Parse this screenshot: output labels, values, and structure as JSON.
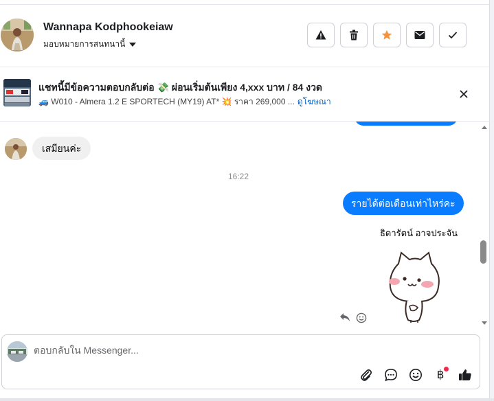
{
  "header": {
    "contact_name": "Wannapa Kodphookeiaw",
    "assign_label": "มอบหมายการสนทนานี้",
    "actions": [
      {
        "name": "report-button",
        "icon": "warning-icon"
      },
      {
        "name": "delete-button",
        "icon": "trash-icon"
      },
      {
        "name": "star-button",
        "icon": "star-icon",
        "color": "#f7923b"
      },
      {
        "name": "mark-unread-button",
        "icon": "envelope-icon"
      },
      {
        "name": "mark-done-button",
        "icon": "check-icon"
      }
    ]
  },
  "ad": {
    "title": "แชทนี้มีข้อความตอบกลับต่อ 💸 ผ่อนเริ่มต้นเพียง 4,xxx บาท / 84 งวด",
    "subtitle": "🚙 W010 - Almera 1.2 E SPORTECH (MY19) AT* 💥 ราคา 269,000 ...",
    "link_label": "ดูโฆษณา"
  },
  "chat": {
    "incoming_message": "เสมียนค่ะ",
    "timestamp": "16:22",
    "outgoing_message": "รายได้ต่อเดือนเท่าไหร่คะ",
    "sender_name": "ธิดารัตน์ อาจประจัน",
    "sticker": "cat-sticker-icon"
  },
  "composer": {
    "placeholder": "ตอบกลับใน Messenger...",
    "currency_symbol": "฿"
  },
  "colors": {
    "accent": "#0a7cff",
    "star": "#f7923b",
    "notification": "#f02849"
  }
}
